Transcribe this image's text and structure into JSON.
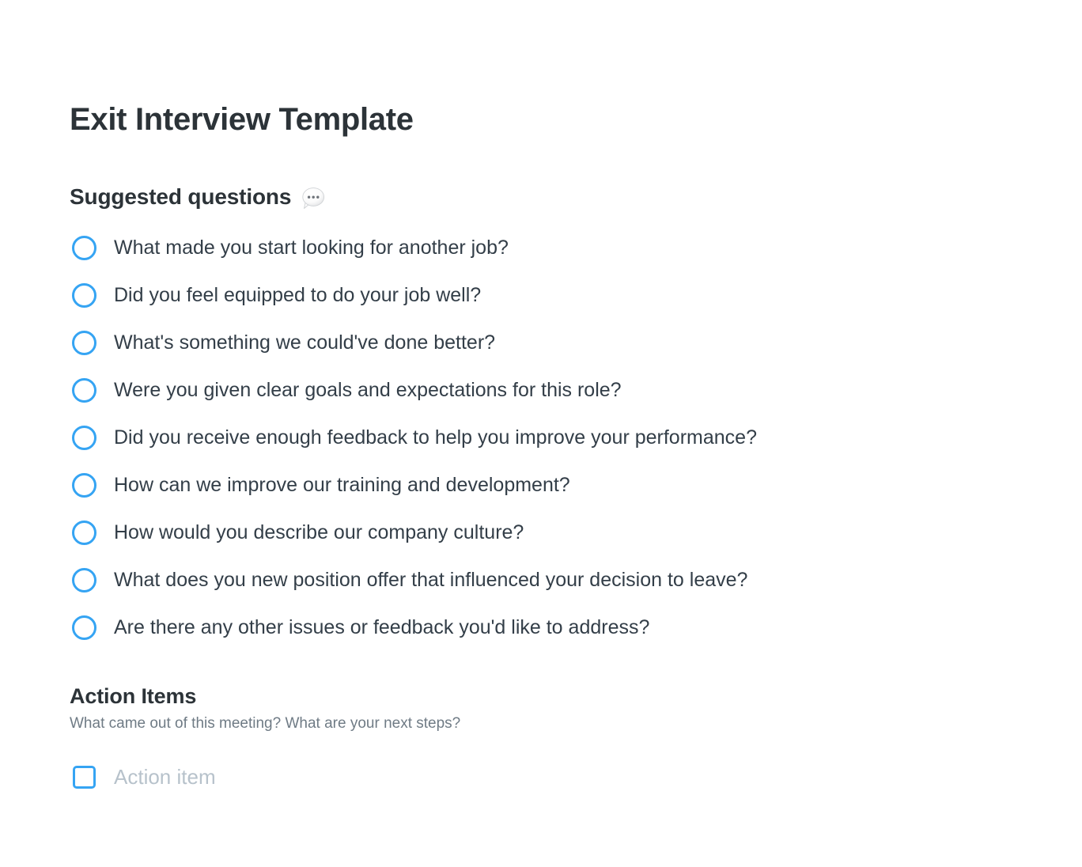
{
  "document": {
    "title": "Exit Interview Template",
    "background_color": "#ffffff",
    "text_color": "#333e48",
    "accent_color": "#35a4f3",
    "muted_text_color": "#6f7b85",
    "placeholder_color": "#b7c2cb"
  },
  "suggested_questions": {
    "heading": "Suggested questions",
    "heading_icon": "speech-balloon-icon",
    "items": [
      {
        "label": "What made you start looking for another job?",
        "control": "radio-circle",
        "checked": false
      },
      {
        "label": "Did you feel equipped to do your job well?",
        "control": "radio-circle",
        "checked": false
      },
      {
        "label": "What's something we could've done better?",
        "control": "radio-circle",
        "checked": false
      },
      {
        "label": "Were you given clear goals and expectations for this role?",
        "control": "radio-circle",
        "checked": false
      },
      {
        "label": "Did you receive enough feedback to help you improve your performance?",
        "control": "radio-circle",
        "checked": false
      },
      {
        "label": "How can we improve our training and development?",
        "control": "radio-circle",
        "checked": false
      },
      {
        "label": "How would you describe our company culture?",
        "control": "radio-circle",
        "checked": false
      },
      {
        "label": "What does you new position offer that influenced your decision to leave?",
        "control": "radio-circle",
        "checked": false
      },
      {
        "label": "Are there any other issues or feedback you'd like to address?",
        "control": "radio-circle",
        "checked": false
      }
    ]
  },
  "action_items": {
    "heading": "Action Items",
    "description": "What came out of this meeting? What are your next steps?",
    "items": [
      {
        "label": "Action item",
        "control": "checkbox-square",
        "checked": false,
        "is_placeholder": true
      }
    ]
  }
}
